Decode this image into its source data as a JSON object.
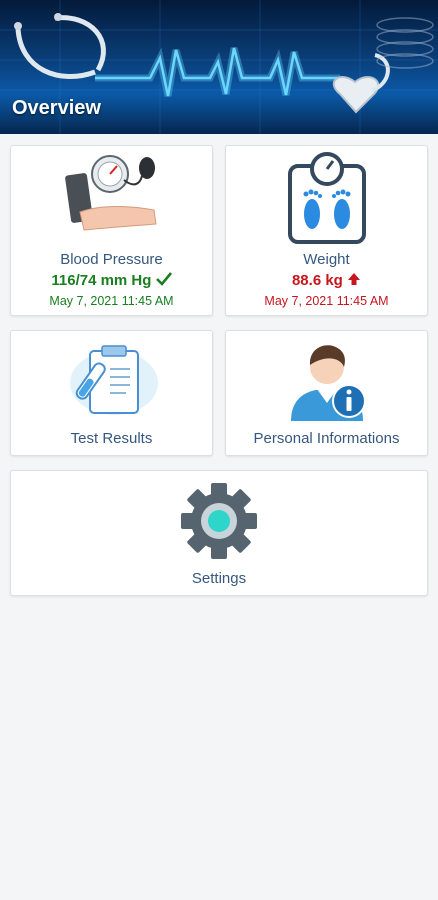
{
  "header": {
    "title": "Overview"
  },
  "tiles": {
    "blood_pressure": {
      "label": "Blood Pressure",
      "value": "116/74 mm Hg",
      "status_icon": "check-icon",
      "time": "May 7, 2021 11:45 AM",
      "color": "#1a7f20"
    },
    "weight": {
      "label": "Weight",
      "value": "88.6 kg",
      "status_icon": "arrow-up-icon",
      "time": "May 7, 2021 11:45 AM",
      "color": "#c7161d"
    },
    "test_results": {
      "label": "Test Results",
      "icon": "clipboard-test-tube-icon"
    },
    "personal_info": {
      "label": "Personal Informations",
      "icon": "person-info-icon"
    },
    "settings": {
      "label": "Settings",
      "icon": "gear-icon"
    }
  },
  "colors": {
    "label": "#36587e",
    "background": "#f4f5f7",
    "header": "#0a3f7a"
  }
}
